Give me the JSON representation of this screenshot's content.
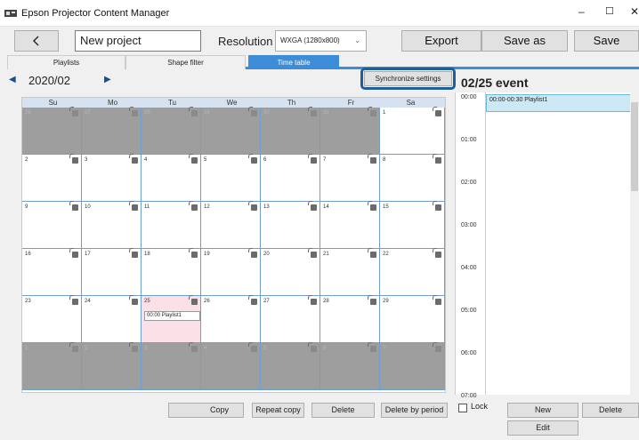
{
  "window": {
    "title": "Epson Projector Content Manager",
    "minimize": "–",
    "maximize": "☐",
    "close": "✕"
  },
  "toolbar": {
    "project_name": "New project",
    "resolution_label": "Resolution :",
    "resolution_value": "WXGA (1280x800)",
    "export_label": "Export",
    "save_as_label": "Save as",
    "save_label": "Save"
  },
  "tabs": [
    {
      "label": "Playlists"
    },
    {
      "label": "Shape filter"
    },
    {
      "label": "Time table"
    }
  ],
  "calendar": {
    "month": "2020/02",
    "sync_label": "Synchronize settings",
    "weekdays": [
      "Su",
      "Mo",
      "Tu",
      "We",
      "Th",
      "Fr",
      "Sa"
    ],
    "weeks": [
      [
        {
          "d": "26",
          "gray": true
        },
        {
          "d": "27",
          "gray": true
        },
        {
          "d": "28",
          "gray": true
        },
        {
          "d": "29",
          "gray": true
        },
        {
          "d": "30",
          "gray": true
        },
        {
          "d": "31",
          "gray": true
        },
        {
          "d": "1"
        }
      ],
      [
        {
          "d": "2"
        },
        {
          "d": "3"
        },
        {
          "d": "4"
        },
        {
          "d": "5"
        },
        {
          "d": "6"
        },
        {
          "d": "7"
        },
        {
          "d": "8"
        }
      ],
      [
        {
          "d": "9"
        },
        {
          "d": "10"
        },
        {
          "d": "11"
        },
        {
          "d": "12"
        },
        {
          "d": "13"
        },
        {
          "d": "14"
        },
        {
          "d": "15"
        }
      ],
      [
        {
          "d": "16"
        },
        {
          "d": "17"
        },
        {
          "d": "18"
        },
        {
          "d": "19"
        },
        {
          "d": "20"
        },
        {
          "d": "21"
        },
        {
          "d": "22"
        }
      ],
      [
        {
          "d": "23"
        },
        {
          "d": "24"
        },
        {
          "d": "25",
          "sel": true,
          "event": "00:00 Playlist1"
        },
        {
          "d": "26"
        },
        {
          "d": "27"
        },
        {
          "d": "28"
        },
        {
          "d": "29"
        }
      ],
      [
        {
          "d": "1",
          "gray": true
        },
        {
          "d": "2",
          "gray": true
        },
        {
          "d": "3",
          "gray": true
        },
        {
          "d": "4",
          "gray": true
        },
        {
          "d": "5",
          "gray": true
        },
        {
          "d": "6",
          "gray": true
        },
        {
          "d": "7",
          "gray": true
        }
      ]
    ]
  },
  "event": {
    "title": "02/25 event",
    "times": [
      "00:00",
      "01:00",
      "02:00",
      "03:00",
      "04:00",
      "05:00",
      "06:00",
      "07:00"
    ],
    "block_label": "00:00-00:30 Playlist1"
  },
  "bottom": {
    "copy": "Copy",
    "repeat_copy": "Repeat copy",
    "delete": "Delete",
    "delete_period": "Delete by period",
    "lock": "Lock",
    "new": "New",
    "delete2": "Delete",
    "edit": "Edit"
  },
  "colors": {
    "accent": "#3c8cd8",
    "highlight": "#1e5f99"
  }
}
